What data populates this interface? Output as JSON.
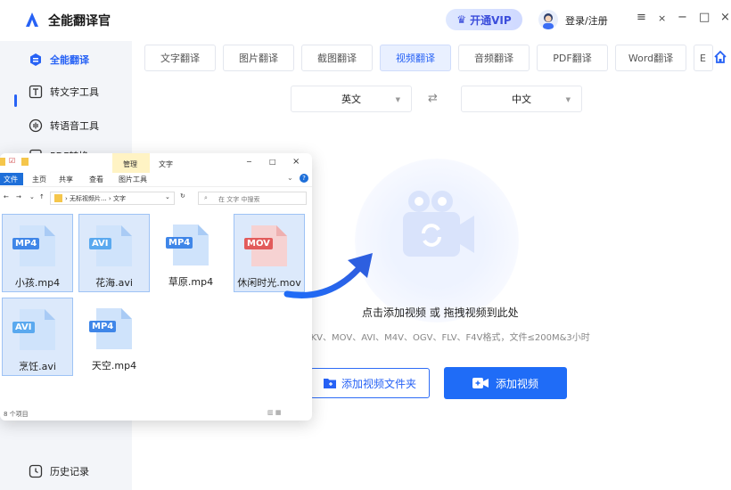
{
  "app": {
    "title": "全能翻译官",
    "vip_label": "开通VIP",
    "login_label": "登录/注册",
    "accent": "#2762f5"
  },
  "window_controls": {
    "menu": "≡",
    "close_x": "×",
    "minimize": "−",
    "maximize": "□",
    "close": "×"
  },
  "sidebar": {
    "items": [
      {
        "label": "全能翻译",
        "icon": "translate-icon",
        "active": true
      },
      {
        "label": "转文字工具",
        "icon": "text-icon"
      },
      {
        "label": "转语音工具",
        "icon": "voice-icon"
      },
      {
        "label": "PDF转换",
        "icon": "pdf-icon"
      },
      {
        "label": "",
        "icon": ""
      },
      {
        "label": "",
        "icon": ""
      },
      {
        "label": "历史记录",
        "icon": "history-icon"
      }
    ]
  },
  "tabs": [
    {
      "label": "文字翻译"
    },
    {
      "label": "图片翻译"
    },
    {
      "label": "截图翻译"
    },
    {
      "label": "视频翻译",
      "active": true
    },
    {
      "label": "音频翻译"
    },
    {
      "label": "PDF翻译"
    },
    {
      "label": "Word翻译"
    },
    {
      "label": "E"
    }
  ],
  "languages": {
    "source": "英文",
    "target": "中文"
  },
  "main": {
    "hint": "点击添加视频 或 拖拽视频到此处",
    "formats": "MKV、MOV、AVI、M4V、OGV、FLV、F4V格式，文件≤200M&3小时",
    "add_folder_label": "添加视频文件夹",
    "add_video_label": "添加视频"
  },
  "explorer": {
    "ribbon_tag": "管理",
    "folder_title": "文字",
    "menus": [
      "文件",
      "主页",
      "共享",
      "查看",
      "图片工具"
    ],
    "path": "› 无标视频片... › 文字",
    "search_placeholder": "在 文字 中搜索",
    "status": "8 个项目",
    "files": [
      {
        "name": "小孩.mp4",
        "badge": "MP4",
        "selected": true,
        "color": "#3f86e8"
      },
      {
        "name": "花海.avi",
        "badge": "AVI",
        "selected": true,
        "color": "#5aa9ef"
      },
      {
        "name": "草原.mp4",
        "badge": "MP4",
        "selected": false,
        "color": "#3f86e8"
      },
      {
        "name": "休闲时光.mov",
        "badge": "MOV",
        "selected": true,
        "color": "#e25b5b"
      },
      {
        "name": "烹饪.avi",
        "badge": "AVI",
        "selected": true,
        "color": "#5aa9ef"
      },
      {
        "name": "天空.mp4",
        "badge": "MP4",
        "selected": false,
        "color": "#3f86e8"
      }
    ]
  }
}
